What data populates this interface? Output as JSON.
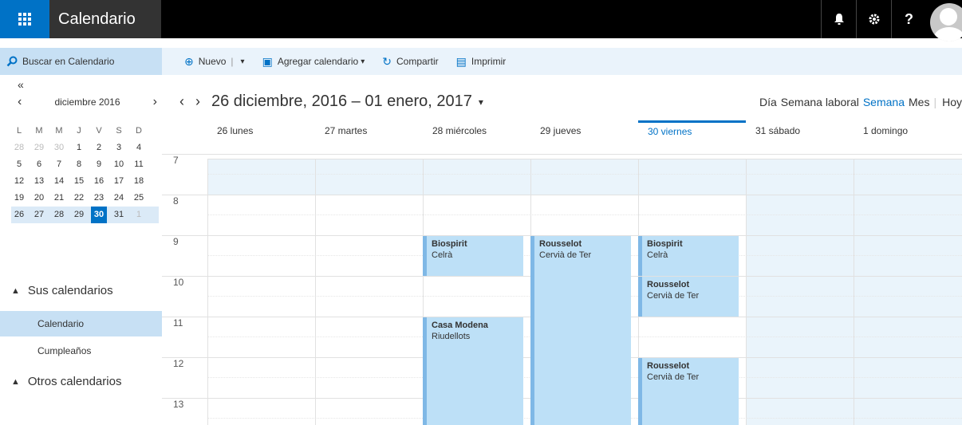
{
  "app": {
    "title": "Calendario"
  },
  "search": {
    "label": "Buscar en Calendario"
  },
  "toolbar": {
    "new_label": "Nuevo",
    "add_calendar_label": "Agregar calendario",
    "share_label": "Compartir",
    "print_label": "Imprimir"
  },
  "mini_calendar": {
    "collapse": "«",
    "month": "diciembre 2016",
    "dow": [
      "L",
      "M",
      "M",
      "J",
      "V",
      "S",
      "D"
    ],
    "weeks": [
      [
        "28",
        "29",
        "30",
        "1",
        "2",
        "3",
        "4"
      ],
      [
        "5",
        "6",
        "7",
        "8",
        "9",
        "10",
        "11"
      ],
      [
        "12",
        "13",
        "14",
        "15",
        "16",
        "17",
        "18"
      ],
      [
        "19",
        "20",
        "21",
        "22",
        "23",
        "24",
        "25"
      ],
      [
        "26",
        "27",
        "28",
        "29",
        "30",
        "31",
        "1"
      ]
    ],
    "today": "30"
  },
  "sidebar": {
    "your_calendars": "Sus calendarios",
    "items": [
      "Calendario",
      "Cumpleaños"
    ],
    "other_calendars": "Otros calendarios"
  },
  "view": {
    "range": "26 diciembre, 2016 – 01 enero, 2017",
    "modes": {
      "day": "Día",
      "work_week": "Semana laboral",
      "week": "Semana",
      "month": "Mes",
      "today": "Hoy"
    },
    "active_mode": "Semana"
  },
  "days": [
    "26 lunes",
    "27 martes",
    "28 miércoles",
    "29 jueves",
    "30 viernes",
    "31 sábado",
    "1 domingo"
  ],
  "today_index": 4,
  "hours": [
    "7",
    "8",
    "9",
    "10",
    "11",
    "12",
    "13"
  ],
  "events": [
    {
      "title": "Biospirit",
      "location": "Celrà"
    },
    {
      "title": "Rousselot",
      "location": "Cervià de Ter"
    },
    {
      "title": "Biospirit",
      "location": "Celrà"
    },
    {
      "title": "Rousselot",
      "location": "Cervià de Ter"
    },
    {
      "title": "Casa Modena",
      "location": "Riudellots"
    },
    {
      "title": "Rousselot",
      "location": "Cervià de Ter"
    }
  ],
  "colors": {
    "accent": "#0072c6",
    "event_bg": "#bde0f7",
    "event_bar": "#7fb8e6",
    "selected_nav": "#c7e0f4"
  },
  "icons": {
    "apps": "waffle-icon",
    "bell": "bell-icon",
    "settings": "gear-icon",
    "help": "help-icon"
  }
}
